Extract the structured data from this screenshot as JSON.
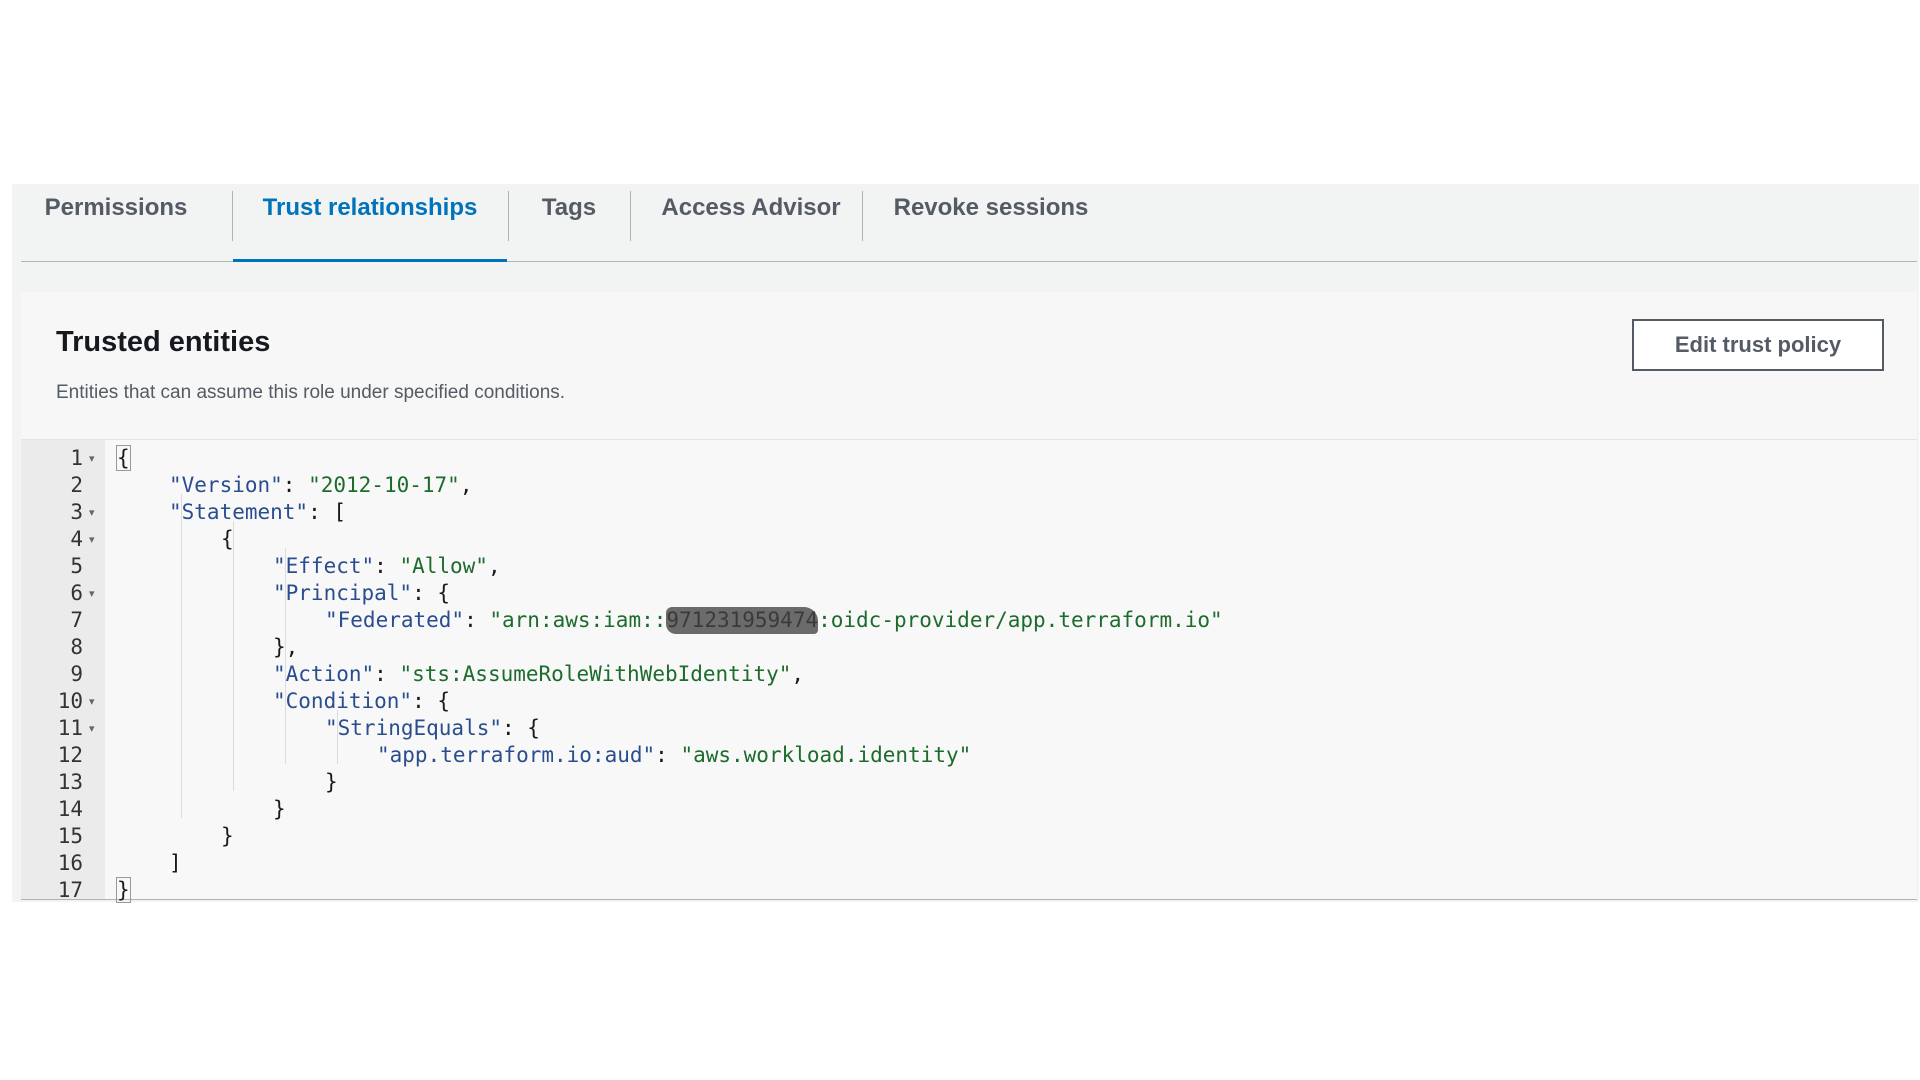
{
  "tabs": [
    {
      "label": "Permissions",
      "active": false
    },
    {
      "label": "Trust relationships",
      "active": true
    },
    {
      "label": "Tags",
      "active": false
    },
    {
      "label": "Access Advisor",
      "active": false
    },
    {
      "label": "Revoke sessions",
      "active": false
    }
  ],
  "panel": {
    "title": "Trusted entities",
    "description": "Entities that can assume this role under specified conditions.",
    "edit_button_label": "Edit trust policy"
  },
  "editor": {
    "lines": [
      {
        "n": "1",
        "fold": true
      },
      {
        "n": "2",
        "fold": false
      },
      {
        "n": "3",
        "fold": true
      },
      {
        "n": "4",
        "fold": true
      },
      {
        "n": "5",
        "fold": false
      },
      {
        "n": "6",
        "fold": true
      },
      {
        "n": "7",
        "fold": false
      },
      {
        "n": "8",
        "fold": false
      },
      {
        "n": "9",
        "fold": false
      },
      {
        "n": "10",
        "fold": true
      },
      {
        "n": "11",
        "fold": true
      },
      {
        "n": "12",
        "fold": false
      },
      {
        "n": "13",
        "fold": false
      },
      {
        "n": "14",
        "fold": false
      },
      {
        "n": "15",
        "fold": false
      },
      {
        "n": "16",
        "fold": false
      },
      {
        "n": "17",
        "fold": false
      }
    ],
    "code": {
      "l1": "{",
      "l2_key": "\"Version\"",
      "l2_sep": ": ",
      "l2_val": "\"2012-10-17\"",
      "l2_end": ",",
      "l3_key": "\"Statement\"",
      "l3_end": ": [",
      "l4": "{",
      "l5_key": "\"Effect\"",
      "l5_sep": ": ",
      "l5_val": "\"Allow\"",
      "l5_end": ",",
      "l6_key": "\"Principal\"",
      "l6_end": ": {",
      "l7_key": "\"Federated\"",
      "l7_sep": ": ",
      "l7_val_pre": "\"arn:aws:iam::",
      "l7_val_redacted": "971231959474",
      "l7_val_post": ":oidc-provider/app.terraform.io\"",
      "l8": "},",
      "l9_key": "\"Action\"",
      "l9_sep": ": ",
      "l9_val": "\"sts:AssumeRoleWithWebIdentity\"",
      "l9_end": ",",
      "l10_key": "\"Condition\"",
      "l10_end": ": {",
      "l11_key": "\"StringEquals\"",
      "l11_end": ": {",
      "l12_key": "\"app.terraform.io:aud\"",
      "l12_sep": ": ",
      "l12_val": "\"aws.workload.identity\"",
      "l13": "}",
      "l14": "}",
      "l15": "}",
      "l16": "]",
      "l17": "}"
    }
  },
  "colors": {
    "active_tab": "#0073bb",
    "key": "#2a4d8f",
    "string": "#1d6b2d",
    "redaction": "#6b6b6b"
  }
}
